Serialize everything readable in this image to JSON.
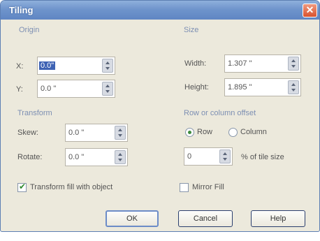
{
  "window": {
    "title": "Tiling",
    "close_icon": "close-icon"
  },
  "origin": {
    "group_label": "Origin",
    "x_label": "X:",
    "x_value": "0.0\"",
    "y_label": "Y:",
    "y_value": "0.0 \""
  },
  "size": {
    "group_label": "Size",
    "width_label": "Width:",
    "width_value": "1.307 \"",
    "height_label": "Height:",
    "height_value": "1.895 \""
  },
  "transform": {
    "group_label": "Transform",
    "skew_label": "Skew:",
    "skew_value": "0.0 \"",
    "rotate_label": "Rotate:",
    "rotate_value": "0.0 \""
  },
  "offset": {
    "group_label": "Row or column offset",
    "row_label": "Row",
    "column_label": "Column",
    "selected": "Row",
    "percent_value": "0",
    "percent_label": "% of tile size"
  },
  "options": {
    "transform_fill_label": "Transform fill with object",
    "transform_fill_checked": true,
    "mirror_fill_label": "Mirror Fill",
    "mirror_fill_checked": false
  },
  "buttons": {
    "ok": "OK",
    "cancel": "Cancel",
    "help": "Help"
  },
  "colors": {
    "titlebar": "#6f94cc",
    "close": "#d9522e",
    "dialog_bg": "#ece9dc",
    "group_label": "#7d8fb3"
  }
}
